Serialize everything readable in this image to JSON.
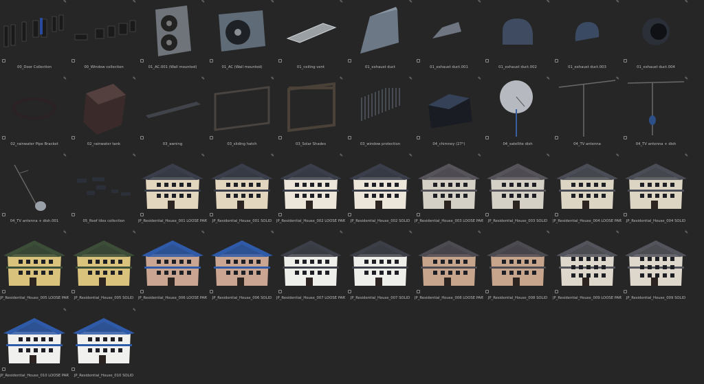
{
  "assets": [
    {
      "label": "00_Door Collection",
      "kind": "doors",
      "icon": "asset-icon"
    },
    {
      "label": "00_Window collection",
      "kind": "windows",
      "icon": "asset-icon"
    },
    {
      "label": "01_AC.001 (Wall mounted)",
      "kind": "ac",
      "icon": "pin-icon"
    },
    {
      "label": "01_AC (Wall mounted)",
      "kind": "ac2",
      "icon": "pin-icon"
    },
    {
      "label": "01_ceiling vent",
      "kind": "vent",
      "icon": "pin-icon"
    },
    {
      "label": "01_exhaust duct",
      "kind": "duct-tall",
      "icon": "pin-icon"
    },
    {
      "label": "01_exhaust duct.001",
      "kind": "duct-small",
      "icon": "pin-icon"
    },
    {
      "label": "01_exhaust duct.002",
      "kind": "dome",
      "icon": "pin-icon"
    },
    {
      "label": "01_exhaust duct.003",
      "kind": "dome-small",
      "icon": "pin-icon"
    },
    {
      "label": "01_exhaust duct.004",
      "kind": "ring-duct",
      "icon": "pin-icon"
    },
    {
      "label": "02_rainwater Pipe Bracket",
      "kind": "ring",
      "icon": "pin-icon"
    },
    {
      "label": "02_rainwater tank",
      "kind": "tank",
      "icon": "pin-icon"
    },
    {
      "label": "03_awning",
      "kind": "awning",
      "icon": "pin-icon"
    },
    {
      "label": "03_sliding hatch",
      "kind": "frame",
      "icon": "pin-icon"
    },
    {
      "label": "03_Solar Shades",
      "kind": "shade",
      "icon": "pin-icon"
    },
    {
      "label": "03_window protection",
      "kind": "grill",
      "icon": "pin-icon"
    },
    {
      "label": "04_chimney (27°)",
      "kind": "chimney",
      "icon": "pin-icon"
    },
    {
      "label": "04_satellite dish",
      "kind": "dish",
      "icon": "pin-icon"
    },
    {
      "label": "04_TV antenna",
      "kind": "antenna",
      "icon": "pin-icon"
    },
    {
      "label": "04_TV antenna + dish",
      "kind": "antenna-dish",
      "icon": "pin-icon"
    },
    {
      "label": "04_TV antenna + dish.001",
      "kind": "antenna-tilt",
      "icon": "pin-icon"
    },
    {
      "label": "05_Roof tiles collection",
      "kind": "tiles",
      "icon": "pin-icon"
    },
    {
      "label": "JP_Residential_House_001 LOOSE PARTS",
      "kind": "house-a",
      "icon": "pin-icon"
    },
    {
      "label": "JP_Residential_House_001 SOLID",
      "kind": "house-a",
      "icon": "pin-icon"
    },
    {
      "label": "JP_Residential_House_002 LOOSE PARTS",
      "kind": "house-b",
      "icon": "pin-icon"
    },
    {
      "label": "JP_Residential_House_002 SOLID",
      "kind": "house-b",
      "icon": "pin-icon"
    },
    {
      "label": "JP_Residential_House_003 LOOSE PARTS",
      "kind": "house-c",
      "icon": "pin-icon"
    },
    {
      "label": "JP_Residential_House_003 SOLID",
      "kind": "house-c",
      "icon": "pin-icon"
    },
    {
      "label": "JP_Residential_House_004 LOOSE PARTS",
      "kind": "house-d",
      "icon": "pin-icon"
    },
    {
      "label": "JP_Residential_House_004 SOLID",
      "kind": "house-d",
      "icon": "pin-icon"
    },
    {
      "label": "JP_Residential_House_005 LOOSE PARTS",
      "kind": "house-e",
      "icon": "asset-icon"
    },
    {
      "label": "JP_Residential_House_005 SOLID",
      "kind": "house-e",
      "icon": "asset-icon"
    },
    {
      "label": "JP_Residential_House_006 LOOSE PARTS",
      "kind": "house-f",
      "icon": "asset-icon"
    },
    {
      "label": "JP_Residential_House_006 SOLID",
      "kind": "house-f",
      "icon": "asset-icon"
    },
    {
      "label": "JP_Residential_House_007 LOOSE PARTS",
      "kind": "house-g",
      "icon": "asset-icon"
    },
    {
      "label": "JP_Residential_House_007 SOLID",
      "kind": "house-g",
      "icon": "asset-icon"
    },
    {
      "label": "JP_Residential_House_008 LOOSE PARTS",
      "kind": "house-h",
      "icon": "asset-icon"
    },
    {
      "label": "JP_Residential_House_008 SOLID",
      "kind": "house-h",
      "icon": "asset-icon"
    },
    {
      "label": "JP_Residential_House_009 LOOSE PARTS",
      "kind": "house-i",
      "icon": "asset-icon"
    },
    {
      "label": "JP_Residential_House_009 SOLID",
      "kind": "house-i",
      "icon": "asset-icon"
    },
    {
      "label": "JP_Residential_House_010 LOOSE PARTS",
      "kind": "house-j",
      "icon": "asset-icon"
    },
    {
      "label": "JP_Residential_House_010 SOLID",
      "kind": "house-j",
      "icon": "asset-icon"
    }
  ],
  "colors": {
    "background": "#262626",
    "label": "#bdbdbd",
    "roof_dark": "#3a3e4a",
    "roof_blue": "#2f5aa8",
    "roof_green": "#3c4d38",
    "wall_cream": "#e2d6bf",
    "wall_yellow": "#d8c27c",
    "wall_white": "#eeeeea",
    "wall_pink": "#c9a592",
    "wall_gray": "#d5d0c6"
  }
}
